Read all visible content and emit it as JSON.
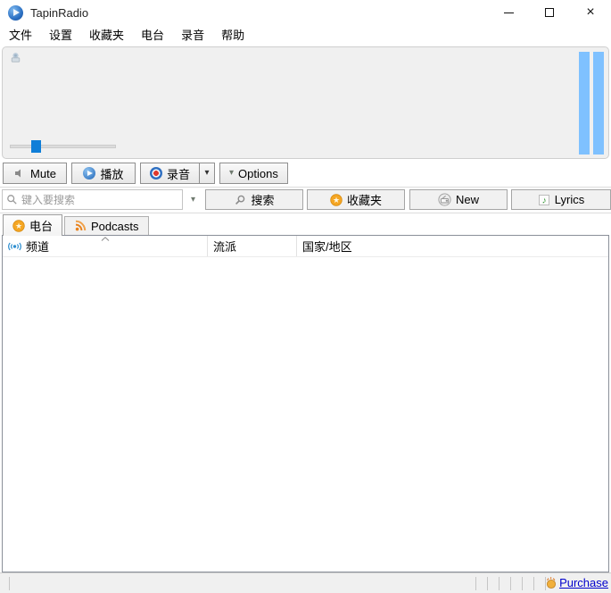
{
  "window": {
    "title": "TapinRadio",
    "close_glyph": "×"
  },
  "menu": {
    "items": [
      {
        "label": "文件"
      },
      {
        "label": "设置"
      },
      {
        "label": "收藏夹"
      },
      {
        "label": "电台"
      },
      {
        "label": "录音"
      },
      {
        "label": "帮助"
      }
    ]
  },
  "player": {
    "volume_percent": 20,
    "vu_meter_count": 2
  },
  "toolbar": {
    "mute_label": "Mute",
    "play_label": "播放",
    "record_label": "录音",
    "options_label": "Options"
  },
  "icons": {
    "chevron_down": "▾"
  },
  "search": {
    "placeholder": "键入要搜索",
    "value": "",
    "search_button": "搜索",
    "favorites_button": "收藏夹",
    "new_button": "New",
    "lyrics_button": "Lyrics"
  },
  "tabs": [
    {
      "label": "电台",
      "active": true
    },
    {
      "label": "Podcasts",
      "active": false
    }
  ],
  "table": {
    "columns": [
      {
        "label": "频道"
      },
      {
        "label": "流派"
      },
      {
        "label": "国家/地区"
      }
    ],
    "sort": {
      "column": "频道",
      "direction": "ascending"
    },
    "rows": []
  },
  "statusbar": {
    "purchase_label": "Purchase"
  },
  "colors": {
    "accent_blue": "#0f7ed8",
    "vu_meter_blue": "#7fc1ff",
    "panel_bg": "#f0f0f0",
    "record_red": "#e03a2f",
    "star_gold": "#f5a623",
    "rss_orange": "#e8821e",
    "link_blue": "#0000cc"
  }
}
